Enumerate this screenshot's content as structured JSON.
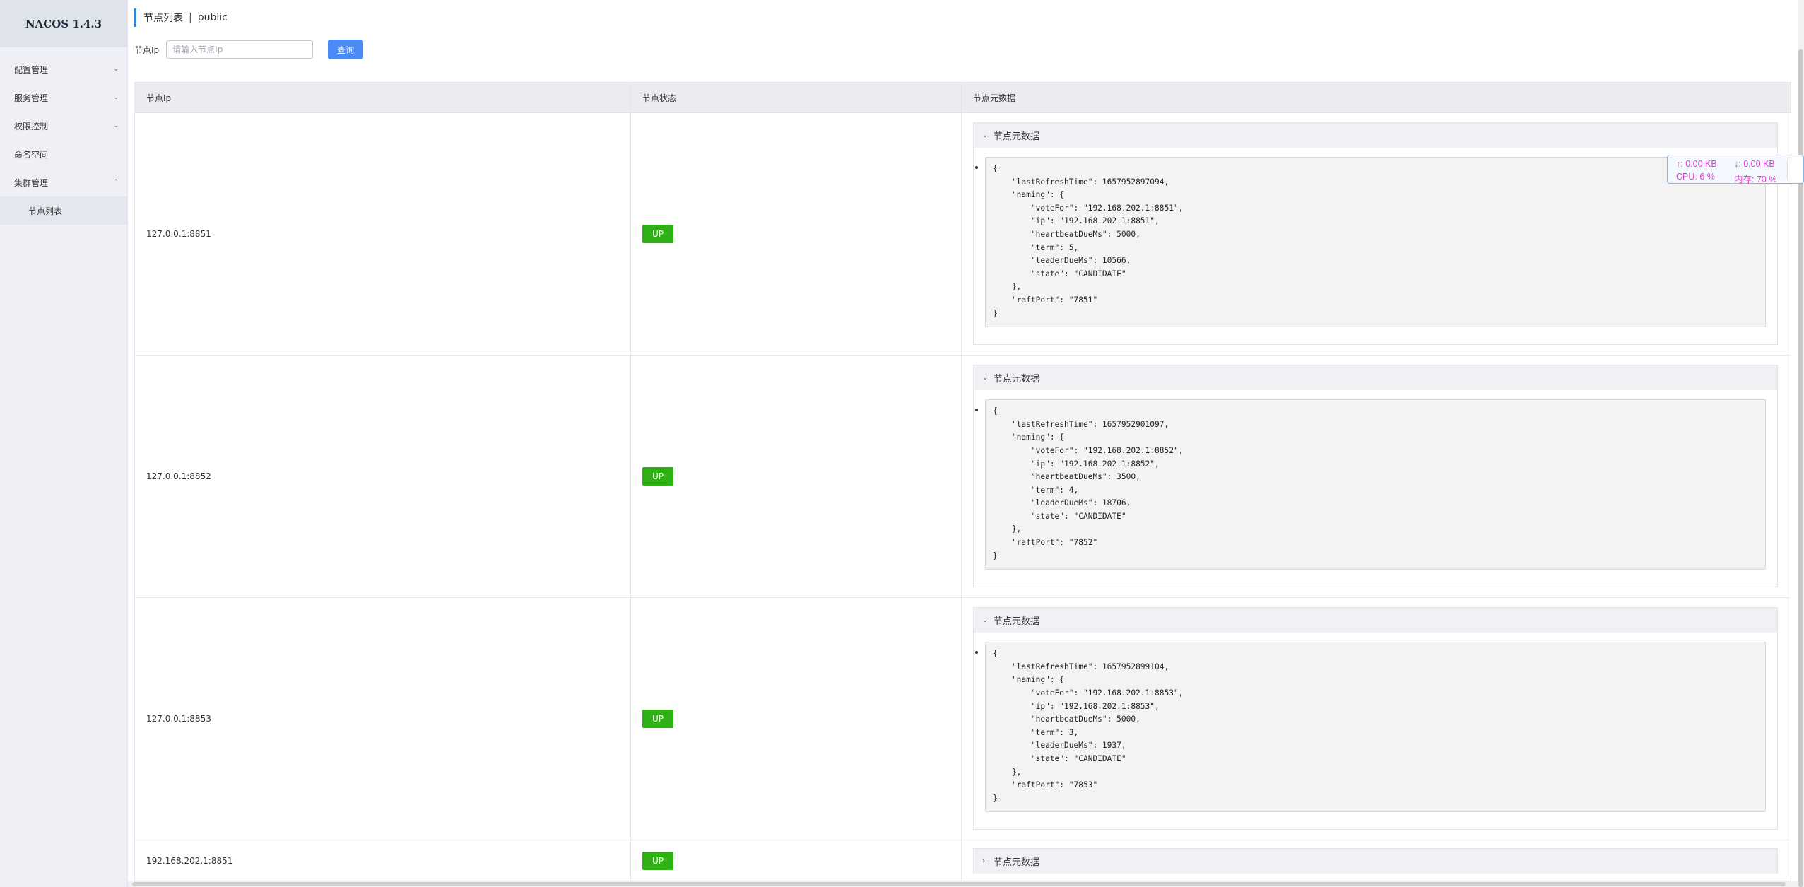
{
  "app": {
    "logo": "NACOS 1.4.3"
  },
  "sidebar": {
    "items": [
      {
        "label": "配置管理",
        "chevron": "down"
      },
      {
        "label": "服务管理",
        "chevron": "down"
      },
      {
        "label": "权限控制",
        "chevron": "down"
      },
      {
        "label": "命名空间"
      },
      {
        "label": "集群管理",
        "chevron": "up"
      }
    ],
    "subitems": [
      {
        "label": "节点列表"
      }
    ]
  },
  "header": {
    "title": "节点列表",
    "separator": "|",
    "namespace": "public"
  },
  "search": {
    "label": "节点Ip",
    "placeholder": "请输入节点Ip",
    "value": "",
    "button": "查询"
  },
  "table": {
    "columns": [
      "节点Ip",
      "节点状态",
      "节点元数据"
    ],
    "rows": [
      {
        "ip": "127.0.0.1:8851",
        "status": "UP",
        "panel_title": "节点元数据",
        "expanded": true,
        "metadata": "{\n    \"lastRefreshTime\": 1657952897094,\n    \"naming\": {\n        \"voteFor\": \"192.168.202.1:8851\",\n        \"ip\": \"192.168.202.1:8851\",\n        \"heartbeatDueMs\": 5000,\n        \"term\": 5,\n        \"leaderDueMs\": 10566,\n        \"state\": \"CANDIDATE\"\n    },\n    \"raftPort\": \"7851\"\n}"
      },
      {
        "ip": "127.0.0.1:8852",
        "status": "UP",
        "panel_title": "节点元数据",
        "expanded": true,
        "metadata": "{\n    \"lastRefreshTime\": 1657952901097,\n    \"naming\": {\n        \"voteFor\": \"192.168.202.1:8852\",\n        \"ip\": \"192.168.202.1:8852\",\n        \"heartbeatDueMs\": 3500,\n        \"term\": 4,\n        \"leaderDueMs\": 18706,\n        \"state\": \"CANDIDATE\"\n    },\n    \"raftPort\": \"7852\"\n}"
      },
      {
        "ip": "127.0.0.1:8853",
        "status": "UP",
        "panel_title": "节点元数据",
        "expanded": true,
        "metadata": "{\n    \"lastRefreshTime\": 1657952899104,\n    \"naming\": {\n        \"voteFor\": \"192.168.202.1:8853\",\n        \"ip\": \"192.168.202.1:8853\",\n        \"heartbeatDueMs\": 5000,\n        \"term\": 3,\n        \"leaderDueMs\": 1937,\n        \"state\": \"CANDIDATE\"\n    },\n    \"raftPort\": \"7853\"\n}"
      },
      {
        "ip": "192.168.202.1:8851",
        "status": "UP",
        "panel_title": "节点元数据",
        "expanded": false
      }
    ]
  },
  "net_monitor": {
    "upload": "↑: 0.00 KB",
    "download": "↓: 0.00 KB",
    "cpu": "CPU: 6 %",
    "memory": "内存: 70 %"
  },
  "colors": {
    "status_up": "#2fb014",
    "primary": "#4a8bf5",
    "accent_bar": "#2d86e0",
    "monitor_text": "#e43ad6"
  }
}
